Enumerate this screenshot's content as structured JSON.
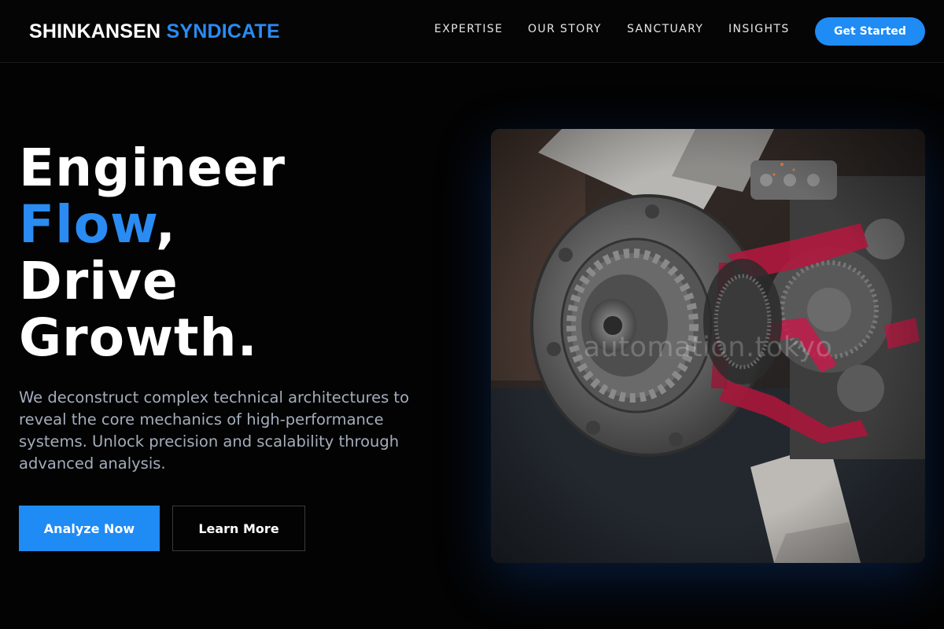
{
  "brand": {
    "name_part1": "SHINKANSEN",
    "name_part2": "SYNDICATE"
  },
  "nav": {
    "links": [
      {
        "label": "EXPERTISE"
      },
      {
        "label": "OUR STORY"
      },
      {
        "label": "SANCTUARY"
      },
      {
        "label": "INSIGHTS"
      }
    ],
    "cta_label": "Get Started"
  },
  "hero": {
    "title_line1": "Engineer",
    "title_line2_accent": "Flow",
    "title_line2_suffix": ",",
    "title_line3": "Drive",
    "title_line4": "Growth.",
    "description": "We deconstruct complex technical architectures to reveal the core mechanics of high-performance systems. Unlock precision and scalability through advanced analysis.",
    "primary_button": "Analyze Now",
    "secondary_button": "Learn More",
    "image_watermark": "automation.tokyo"
  },
  "colors": {
    "accent": "#1f8bf5",
    "background": "#030303",
    "body_text": "#a4adbb"
  }
}
